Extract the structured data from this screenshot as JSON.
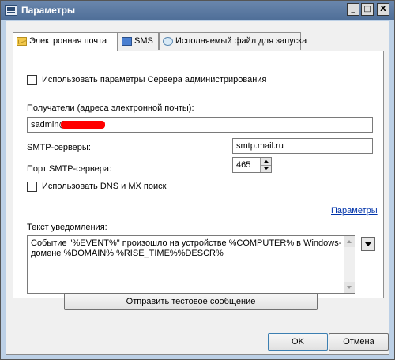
{
  "window": {
    "title": "Параметры",
    "min_glyph": "_",
    "max_glyph": "□",
    "close_glyph": "X"
  },
  "tabs": [
    {
      "label": "Электронная почта",
      "icon": "mail-icon",
      "active": true
    },
    {
      "label": "SMS",
      "icon": "sms-icon",
      "active": false
    },
    {
      "label": "Исполняемый файл для запуска",
      "icon": "exe-icon",
      "active": false
    }
  ],
  "email_tab": {
    "use_admin_server_label": "Использовать параметры Сервера администрирования",
    "use_admin_server_checked": false,
    "recipients_label": "Получатели (адреса электронной почты):",
    "recipients_value": "sadmin@",
    "smtp_servers_label": "SMTP-серверы:",
    "smtp_servers_value": "smtp.mail.ru",
    "smtp_port_label": "Порт SMTP-сервера:",
    "smtp_port_value": "465",
    "use_dns_mx_label": "Использовать DNS и MX поиск",
    "use_dns_mx_checked": false,
    "params_link": "Параметры",
    "notification_label": "Текст уведомления:",
    "notification_text": "Событие \"%EVENT%\" произошло на устройстве %COMPUTER% в Windows-домене %DOMAIN% %RISE_TIME%%DESCR%"
  },
  "buttons": {
    "send_test": "Отправить тестовое сообщение",
    "ok": "OK",
    "cancel": "Отмена"
  },
  "colors": {
    "link": "#0033aa",
    "redaction": "#ff0000"
  }
}
